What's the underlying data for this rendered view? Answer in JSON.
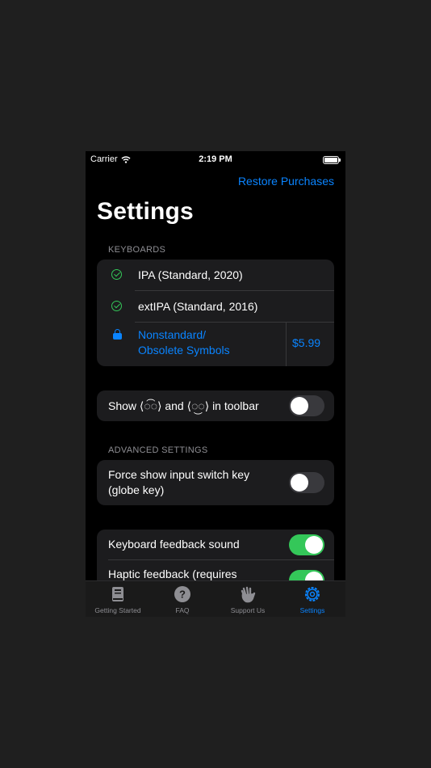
{
  "status_bar": {
    "carrier": "Carrier",
    "time": "2:19 PM"
  },
  "header": {
    "restore_label": "Restore Purchases",
    "title": "Settings"
  },
  "keyboards": {
    "header": "KEYBOARDS",
    "items": [
      {
        "label": "IPA (Standard, 2020)",
        "icon": "check-circle-icon",
        "state": "enabled"
      },
      {
        "label": "extIPA (Standard, 2016)",
        "icon": "check-circle-icon",
        "state": "enabled"
      },
      {
        "label_line1": "Nonstandard/",
        "label_line2": "Obsolete Symbols",
        "icon": "lock-icon",
        "price": "$5.99",
        "state": "locked"
      }
    ]
  },
  "toolbar_option": {
    "label": "Show ⟨◌͡◌⟩ and ⟨◌͜◌⟩ in toolbar",
    "toggle": false
  },
  "advanced": {
    "header": "ADVANCED SETTINGS",
    "globe_label_line1": "Force show input switch key",
    "globe_label_line2": "(globe key)",
    "globe_toggle": false
  },
  "feedback": {
    "sound_label": "Keyboard feedback sound",
    "sound_toggle": true,
    "haptic_label": "Haptic feedback (requires",
    "haptic_toggle": true
  },
  "colors": {
    "accent": "#0a84ff",
    "success": "#34c759",
    "background": "#000000",
    "cell": "#1c1c1e"
  },
  "tab_bar": {
    "tabs": [
      {
        "label": "Getting Started",
        "icon": "book-icon",
        "active": false
      },
      {
        "label": "FAQ",
        "icon": "question-circle-icon",
        "active": false
      },
      {
        "label": "Support Us",
        "icon": "waving-hand-icon",
        "active": false
      },
      {
        "label": "Settings",
        "icon": "gear-icon",
        "active": true
      }
    ]
  }
}
